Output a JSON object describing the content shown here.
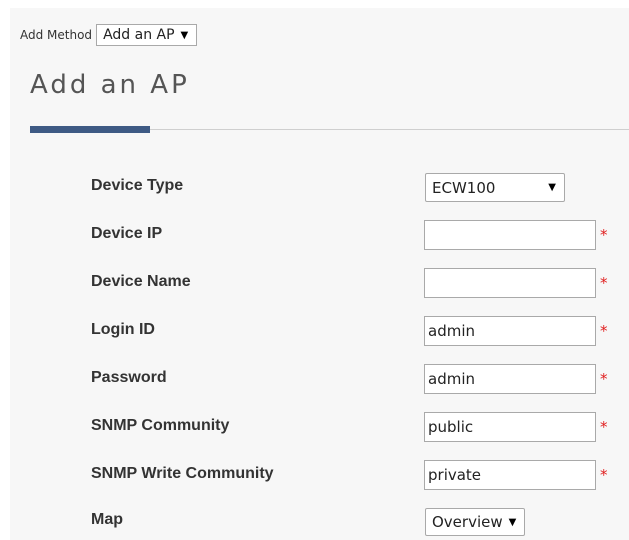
{
  "add_method": {
    "label": "Add Method",
    "selected": "Add an AP",
    "caret": "▼"
  },
  "page": {
    "title": "Add an AP"
  },
  "form": {
    "device_type": {
      "label": "Device Type",
      "selected": "ECW100",
      "caret": "▼"
    },
    "device_ip": {
      "label": "Device IP",
      "value": "",
      "required": "*"
    },
    "device_name": {
      "label": "Device Name",
      "value": "",
      "required": "*"
    },
    "login_id": {
      "label": "Login ID",
      "value": "admin",
      "required": "*"
    },
    "password": {
      "label": "Password",
      "value": "admin",
      "required": "*"
    },
    "snmp_community": {
      "label": "SNMP Community",
      "value": "public",
      "required": "*"
    },
    "snmp_write_community": {
      "label": "SNMP Write Community",
      "value": "private",
      "required": "*"
    },
    "map": {
      "label": "Map",
      "selected": "Overview",
      "caret": "▼"
    }
  },
  "colors": {
    "accent": "#3e5a84",
    "required": "#e02020",
    "panel_background": "#f7f7f7"
  }
}
